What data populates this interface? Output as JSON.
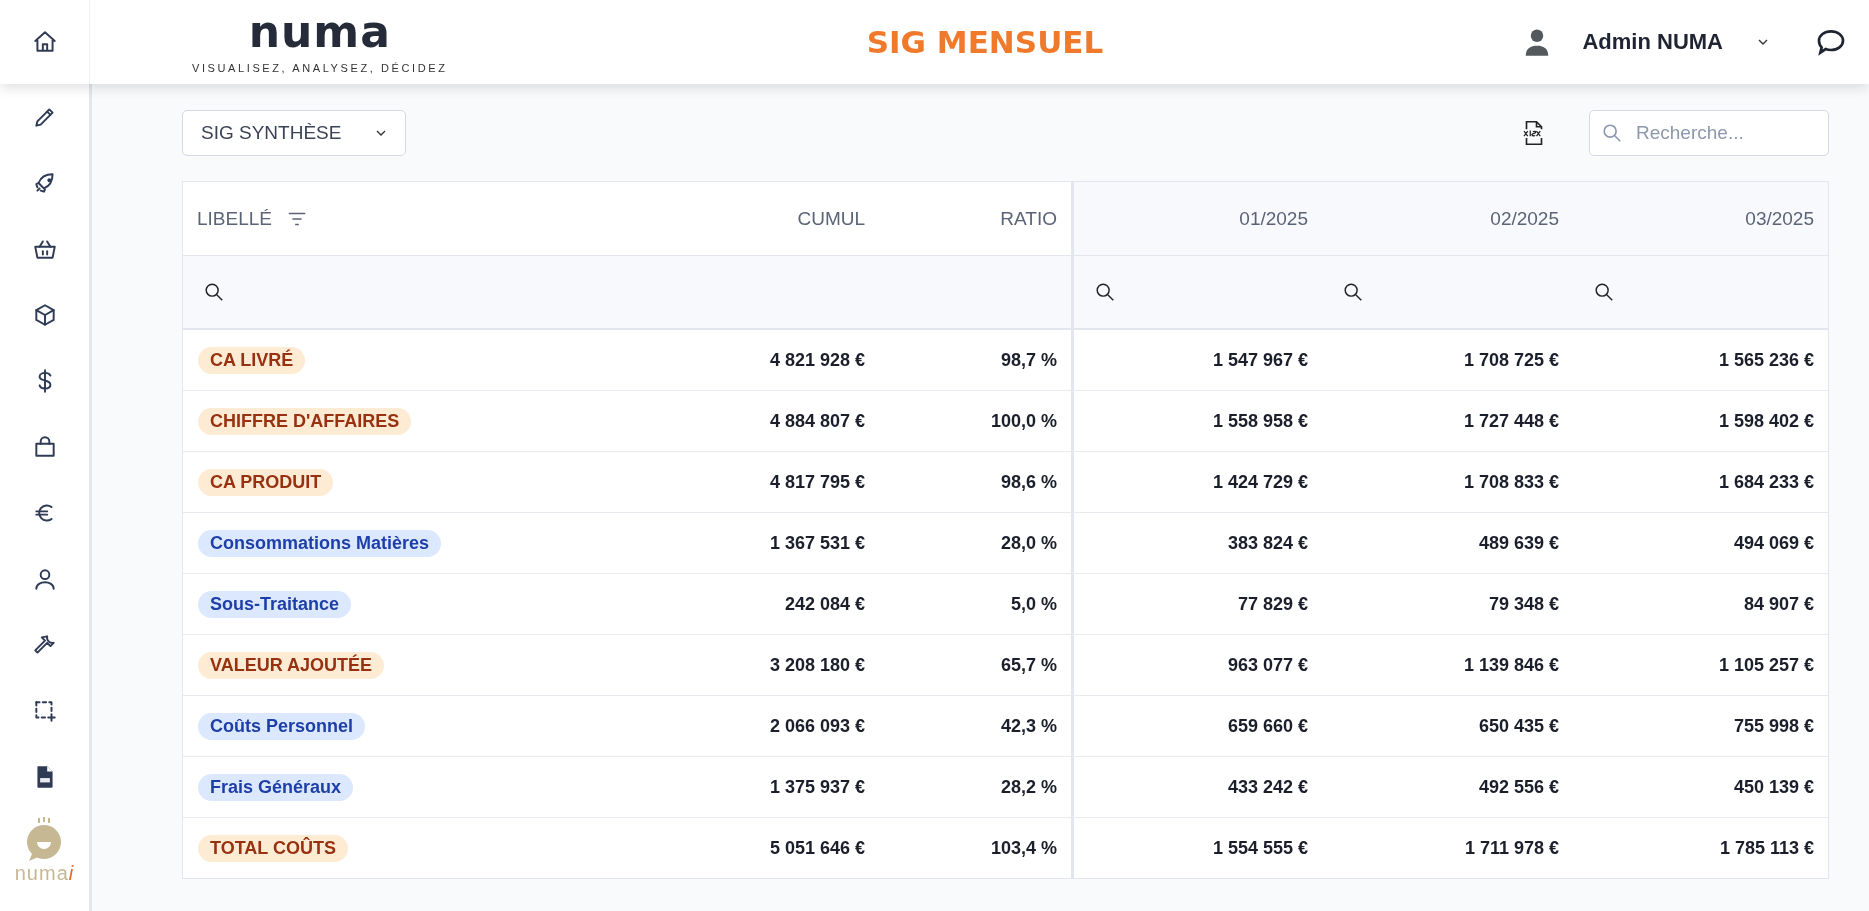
{
  "header": {
    "brand": "numa",
    "tagline": "VISUALISEZ, ANALYSEZ, DÉCIDEZ",
    "title": "SIG MENSUEL",
    "user": "Admin NUMA"
  },
  "sidebar": {
    "logo_text": "numa",
    "logo_accent": "i"
  },
  "toolbar": {
    "view_select": "SIG SYNTHÈSE",
    "search": {
      "placeholder": "Recherche..."
    }
  },
  "table": {
    "columns": [
      {
        "label": "LIBELLÉ",
        "kind": "label"
      },
      {
        "label": "CUMUL",
        "kind": "summary"
      },
      {
        "label": "RATIO",
        "kind": "summary"
      },
      {
        "label": "01/2025",
        "kind": "period"
      },
      {
        "label": "02/2025",
        "kind": "period"
      },
      {
        "label": "03/2025",
        "kind": "period"
      }
    ],
    "rows": [
      {
        "kind": "total",
        "cells": [
          "CA LIVRÉ",
          "4 821 928 €",
          "98,7 %",
          "1 547 967 €",
          "1 708 725 €",
          "1 565 236 €"
        ]
      },
      {
        "kind": "total",
        "cells": [
          "CHIFFRE D'AFFAIRES",
          "4 884 807 €",
          "100,0 %",
          "1 558 958 €",
          "1 727 448 €",
          "1 598 402 €"
        ]
      },
      {
        "kind": "total",
        "cells": [
          "CA PRODUIT",
          "4 817 795 €",
          "98,6 %",
          "1 424 729 €",
          "1 708 833 €",
          "1 684 233 €"
        ]
      },
      {
        "kind": "detail",
        "cells": [
          "Consommations Matières",
          "1 367 531 €",
          "28,0 %",
          "383 824 €",
          "489 639 €",
          "494 069 €"
        ]
      },
      {
        "kind": "detail",
        "cells": [
          "Sous-Traitance",
          "242 084 €",
          "5,0 %",
          "77 829 €",
          "79 348 €",
          "84 907 €"
        ]
      },
      {
        "kind": "total",
        "cells": [
          "VALEUR AJOUTÉE",
          "3 208 180 €",
          "65,7 %",
          "963 077 €",
          "1 139 846 €",
          "1 105 257 €"
        ]
      },
      {
        "kind": "detail",
        "cells": [
          "Coûts Personnel",
          "2 066 093 €",
          "42,3 %",
          "659 660 €",
          "650 435 €",
          "755 998 €"
        ]
      },
      {
        "kind": "detail",
        "cells": [
          "Frais Généraux",
          "1 375 937 €",
          "28,2 %",
          "433 242 €",
          "492 556 €",
          "450 139 €"
        ]
      },
      {
        "kind": "total",
        "cells": [
          "TOTAL COÛTS",
          "5 051 646 €",
          "103,4 %",
          "1 554 555 €",
          "1 711 978 €",
          "1 785 113 €"
        ]
      }
    ]
  }
}
